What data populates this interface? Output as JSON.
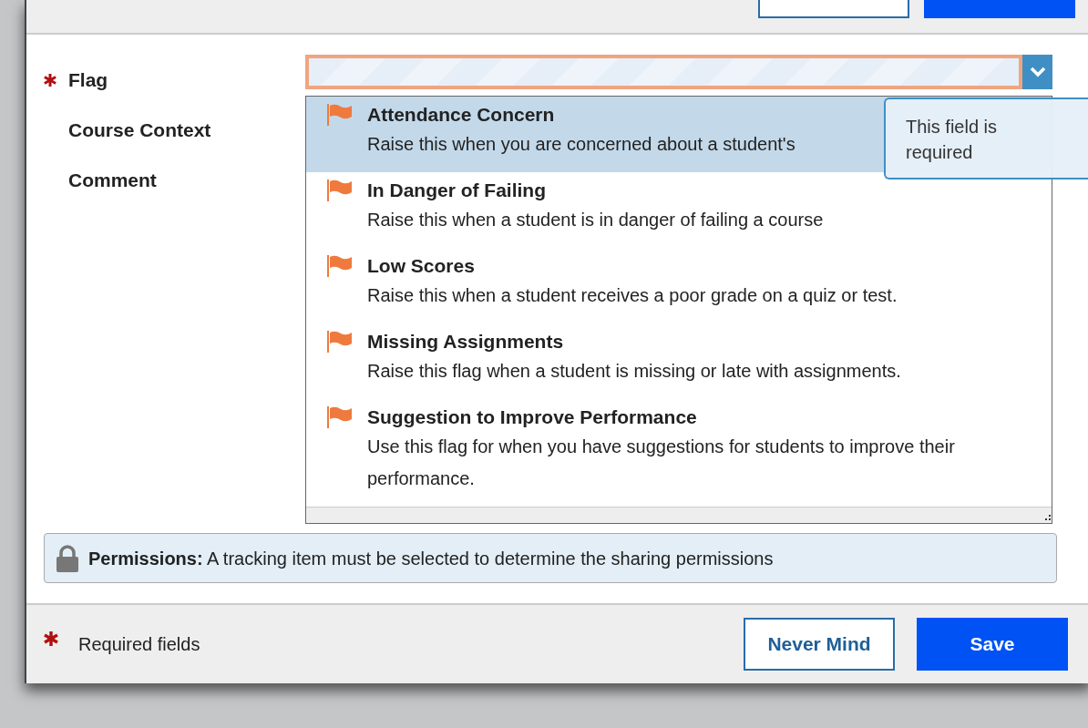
{
  "fields": [
    {
      "label": "Flag",
      "required": true
    },
    {
      "label": "Course Context",
      "required": false
    },
    {
      "label": "Comment",
      "required": false
    }
  ],
  "flag_select": {
    "invalid": true,
    "expanded": true,
    "options": [
      {
        "title": "Attendance Concern",
        "description": "Raise this when you are concerned about a student's",
        "selected": true
      },
      {
        "title": "In Danger of Failing",
        "description": "Raise this when a student is in danger of failing a course",
        "selected": false
      },
      {
        "title": "Low Scores",
        "description": "Raise this when a student receives a poor grade on a quiz or test.",
        "selected": false
      },
      {
        "title": "Missing Assignments",
        "description": "Raise this flag when a student is missing or late with assignments.",
        "selected": false
      },
      {
        "title": "Suggestion to Improve Performance",
        "description": "Use this flag for when you have suggestions for students to improve their performance.",
        "selected": false
      }
    ],
    "tooltip": "This field is required"
  },
  "permissions": "**Permissions:** A tracking item must be selected to determine the sharing permissions",
  "footer": {
    "required_note": "Required fields",
    "buttons": [
      {
        "label": "Never Mind",
        "kind": "outline"
      },
      {
        "label": "Save",
        "kind": "primary"
      }
    ]
  }
}
